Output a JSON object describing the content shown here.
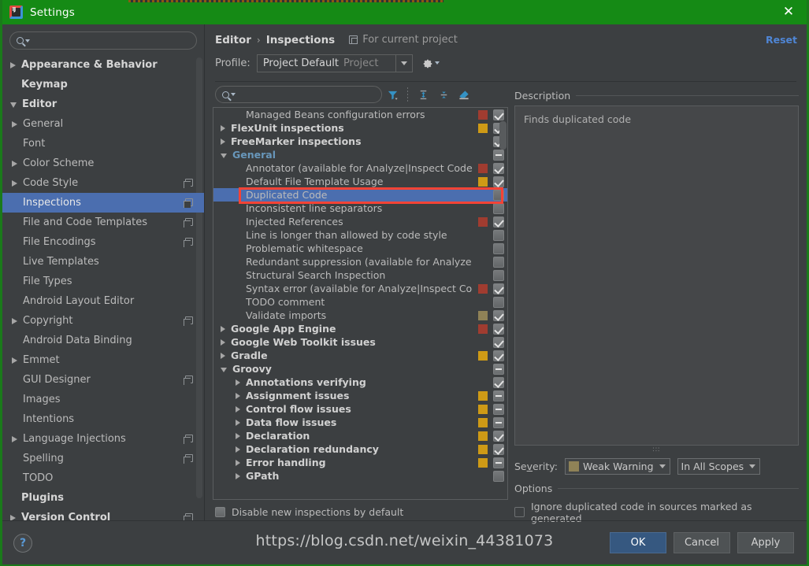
{
  "window": {
    "title": "Settings",
    "app_icon": "intellij-idea-icon",
    "close_icon": "close-icon"
  },
  "sidebar": {
    "search": {
      "placeholder": "",
      "value": "",
      "icon": "search-icon"
    },
    "items": [
      {
        "label": "Appearance & Behavior",
        "level": 0,
        "arrow": "collapsed",
        "copy": false
      },
      {
        "label": "Keymap",
        "level": 0,
        "arrow": "none",
        "copy": false
      },
      {
        "label": "Editor",
        "level": 0,
        "arrow": "expanded",
        "copy": false
      },
      {
        "label": "General",
        "level": 1,
        "arrow": "collapsed",
        "copy": false
      },
      {
        "label": "Font",
        "level": 1,
        "arrow": "none",
        "copy": false
      },
      {
        "label": "Color Scheme",
        "level": 1,
        "arrow": "collapsed",
        "copy": false
      },
      {
        "label": "Code Style",
        "level": 1,
        "arrow": "collapsed",
        "copy": true
      },
      {
        "label": "Inspections",
        "level": 1,
        "arrow": "none",
        "copy": true,
        "selected": true
      },
      {
        "label": "File and Code Templates",
        "level": 1,
        "arrow": "none",
        "copy": true
      },
      {
        "label": "File Encodings",
        "level": 1,
        "arrow": "none",
        "copy": true
      },
      {
        "label": "Live Templates",
        "level": 1,
        "arrow": "none",
        "copy": false
      },
      {
        "label": "File Types",
        "level": 1,
        "arrow": "none",
        "copy": false
      },
      {
        "label": "Android Layout Editor",
        "level": 1,
        "arrow": "none",
        "copy": false
      },
      {
        "label": "Copyright",
        "level": 1,
        "arrow": "collapsed",
        "copy": true
      },
      {
        "label": "Android Data Binding",
        "level": 1,
        "arrow": "none",
        "copy": false
      },
      {
        "label": "Emmet",
        "level": 1,
        "arrow": "collapsed",
        "copy": false
      },
      {
        "label": "GUI Designer",
        "level": 1,
        "arrow": "none",
        "copy": true
      },
      {
        "label": "Images",
        "level": 1,
        "arrow": "none",
        "copy": false
      },
      {
        "label": "Intentions",
        "level": 1,
        "arrow": "none",
        "copy": false
      },
      {
        "label": "Language Injections",
        "level": 1,
        "arrow": "collapsed",
        "copy": true
      },
      {
        "label": "Spelling",
        "level": 1,
        "arrow": "none",
        "copy": true
      },
      {
        "label": "TODO",
        "level": 1,
        "arrow": "none",
        "copy": false
      },
      {
        "label": "Plugins",
        "level": 0,
        "arrow": "none",
        "copy": false
      },
      {
        "label": "Version Control",
        "level": 0,
        "arrow": "collapsed",
        "copy": true
      }
    ]
  },
  "header": {
    "breadcrumb_1": "Editor",
    "breadcrumb_sep": "›",
    "breadcrumb_2": "Inspections",
    "scope_icon": "project-scope-icon",
    "scope_note": "For current project",
    "reset_label": "Reset",
    "profile_label": "Profile:",
    "profile_value": "Project Default",
    "profile_suffix": "Project",
    "gear_icon": "gear-icon"
  },
  "inspections_toolbar": {
    "search": {
      "placeholder": "",
      "value": "",
      "icon": "search-icon"
    },
    "buttons": [
      {
        "icon": "filter-icon",
        "name": "filter-inspections-button"
      },
      {
        "icon": "expand-all-icon",
        "name": "expand-all-button"
      },
      {
        "icon": "collapse-all-icon",
        "name": "collapse-all-button"
      },
      {
        "icon": "reset-to-empty-icon",
        "name": "reset-to-empty-button"
      }
    ]
  },
  "inspections_tree": [
    {
      "label": "Managed Beans configuration errors",
      "level": 1,
      "arrow": "none",
      "group": false,
      "severity": "#a03c30",
      "check": "checked"
    },
    {
      "label": "FlexUnit inspections",
      "level": 0,
      "arrow": "collapsed",
      "group": true,
      "severity": "#ce9a16",
      "check": "checked"
    },
    {
      "label": "FreeMarker inspections",
      "level": 0,
      "arrow": "collapsed",
      "group": true,
      "severity": null,
      "check": "checked"
    },
    {
      "label": "General",
      "level": 0,
      "arrow": "expanded",
      "group": true,
      "blue": true,
      "severity": null,
      "check": "partial"
    },
    {
      "label": "Annotator (available for Analyze|Inspect Code)",
      "level": 1,
      "arrow": "none",
      "group": false,
      "severity": "#a03c30",
      "check": "checked"
    },
    {
      "label": "Default File Template Usage",
      "level": 1,
      "arrow": "none",
      "group": false,
      "severity": "#ce9a16",
      "check": "checked"
    },
    {
      "label": "Duplicated Code",
      "level": 1,
      "arrow": "none",
      "group": false,
      "severity": null,
      "check": "empty",
      "selected": true,
      "highlighted": true
    },
    {
      "label": "Inconsistent line separators",
      "level": 1,
      "arrow": "none",
      "group": false,
      "severity": null,
      "check": "empty"
    },
    {
      "label": "Injected References",
      "level": 1,
      "arrow": "none",
      "group": false,
      "severity": "#a03c30",
      "check": "checked"
    },
    {
      "label": "Line is longer than allowed by code style",
      "level": 1,
      "arrow": "none",
      "group": false,
      "severity": null,
      "check": "empty"
    },
    {
      "label": "Problematic whitespace",
      "level": 1,
      "arrow": "none",
      "group": false,
      "severity": null,
      "check": "empty"
    },
    {
      "label": "Redundant suppression (available for Analyze|In",
      "level": 1,
      "arrow": "none",
      "group": false,
      "severity": null,
      "check": "empty"
    },
    {
      "label": "Structural Search Inspection",
      "level": 1,
      "arrow": "none",
      "group": false,
      "severity": null,
      "check": "empty"
    },
    {
      "label": "Syntax error (available for Analyze|Inspect Code)",
      "level": 1,
      "arrow": "none",
      "group": false,
      "severity": "#a03c30",
      "check": "checked"
    },
    {
      "label": "TODO comment",
      "level": 1,
      "arrow": "none",
      "group": false,
      "severity": null,
      "check": "empty"
    },
    {
      "label": "Validate imports",
      "level": 1,
      "arrow": "none",
      "group": false,
      "severity": "#8f8257",
      "check": "checked"
    },
    {
      "label": "Google App Engine",
      "level": 0,
      "arrow": "collapsed",
      "group": true,
      "severity": "#a03c30",
      "check": "checked"
    },
    {
      "label": "Google Web Toolkit issues",
      "level": 0,
      "arrow": "collapsed",
      "group": true,
      "severity": null,
      "check": "checked"
    },
    {
      "label": "Gradle",
      "level": 0,
      "arrow": "collapsed",
      "group": true,
      "severity": "#ce9a16",
      "check": "checked"
    },
    {
      "label": "Groovy",
      "level": 0,
      "arrow": "expanded",
      "group": true,
      "severity": null,
      "check": "partial"
    },
    {
      "label": "Annotations verifying",
      "level": 1,
      "arrow": "collapsed",
      "group": true,
      "severity": null,
      "check": "checked"
    },
    {
      "label": "Assignment issues",
      "level": 1,
      "arrow": "collapsed",
      "group": true,
      "severity": "#ce9a16",
      "check": "partial"
    },
    {
      "label": "Control flow issues",
      "level": 1,
      "arrow": "collapsed",
      "group": true,
      "severity": "#ce9a16",
      "check": "partial"
    },
    {
      "label": "Data flow issues",
      "level": 1,
      "arrow": "collapsed",
      "group": true,
      "severity": "#ce9a16",
      "check": "partial"
    },
    {
      "label": "Declaration",
      "level": 1,
      "arrow": "collapsed",
      "group": true,
      "severity": "#ce9a16",
      "check": "checked"
    },
    {
      "label": "Declaration redundancy",
      "level": 1,
      "arrow": "collapsed",
      "group": true,
      "severity": "#ce9a16",
      "check": "checked"
    },
    {
      "label": "Error handling",
      "level": 1,
      "arrow": "collapsed",
      "group": true,
      "severity": "#ce9a16",
      "check": "partial"
    },
    {
      "label": "GPath",
      "level": 1,
      "arrow": "collapsed",
      "group": true,
      "severity": null,
      "check": "empty"
    }
  ],
  "disable_new": {
    "label": "Disable new inspections by default",
    "checked": false
  },
  "details": {
    "description_title": "Description",
    "description_text": "Finds duplicated code",
    "grip": "∶∶∶",
    "severity_label": "Severity:",
    "severity_value": "Weak Warning",
    "severity_color": "#8f8257",
    "scope_value": "In All Scopes",
    "options_title": "Options",
    "option_1_label": "Ignore duplicated code in sources marked as generated",
    "option_1_checked": false
  },
  "footer": {
    "help_icon": "help-icon",
    "ok_label": "OK",
    "cancel_label": "Cancel",
    "apply_label": "Apply"
  },
  "watermark": "https://blog.csdn.net/weixin_44381073",
  "colors": {
    "accent_blue": "#4b6eaf",
    "link_blue": "#4f86d6",
    "titlebar_green": "#158a15",
    "error_red": "#a03c30",
    "warning_yellow": "#ce9a16",
    "weak_warning": "#8f8257",
    "highlight_box": "#f44336"
  }
}
